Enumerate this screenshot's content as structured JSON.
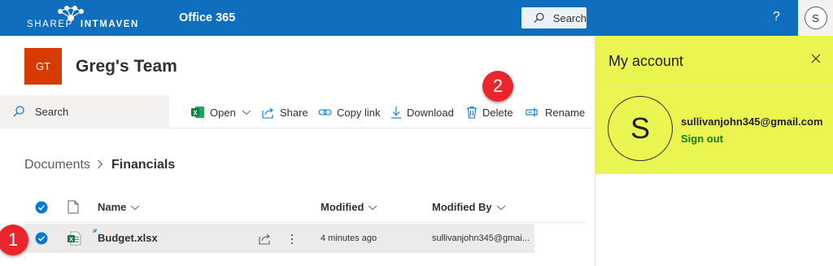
{
  "suite_bar": {
    "logo_text_left": "SHAREP",
    "logo_text_right": "INTMAVEN",
    "app_name": "Office 365",
    "search_label": "Search",
    "help_label": "?",
    "avatar_initial": "S"
  },
  "site": {
    "logo_initials": "GT",
    "title": "Greg's Team",
    "logo_color": "#d83b01"
  },
  "command_bar": {
    "search_label": "Search",
    "open_label": "Open",
    "share_label": "Share",
    "copy_link_label": "Copy link",
    "download_label": "Download",
    "delete_label": "Delete",
    "rename_label": "Rename"
  },
  "breadcrumb": {
    "root": "Documents",
    "current": "Financials"
  },
  "list": {
    "columns": {
      "name": "Name",
      "modified": "Modified",
      "modified_by": "Modified By"
    },
    "rows": [
      {
        "name": "Budget.xlsx",
        "modified": "4 minutes ago",
        "modified_by": "sullivanjohn345@gmai..."
      }
    ]
  },
  "callouts": {
    "first": "1",
    "second": "2"
  },
  "account_panel": {
    "title": "My account",
    "avatar_initial": "S",
    "email": "sullivanjohn345@gmail.com",
    "sign_out_label": "Sign out",
    "highlight_color": "#eaf552"
  },
  "colors": {
    "suite_bar": "#106ebe",
    "callout": "#e8262c",
    "selected_check": "#0078d4",
    "excel_green": "#107c41"
  }
}
